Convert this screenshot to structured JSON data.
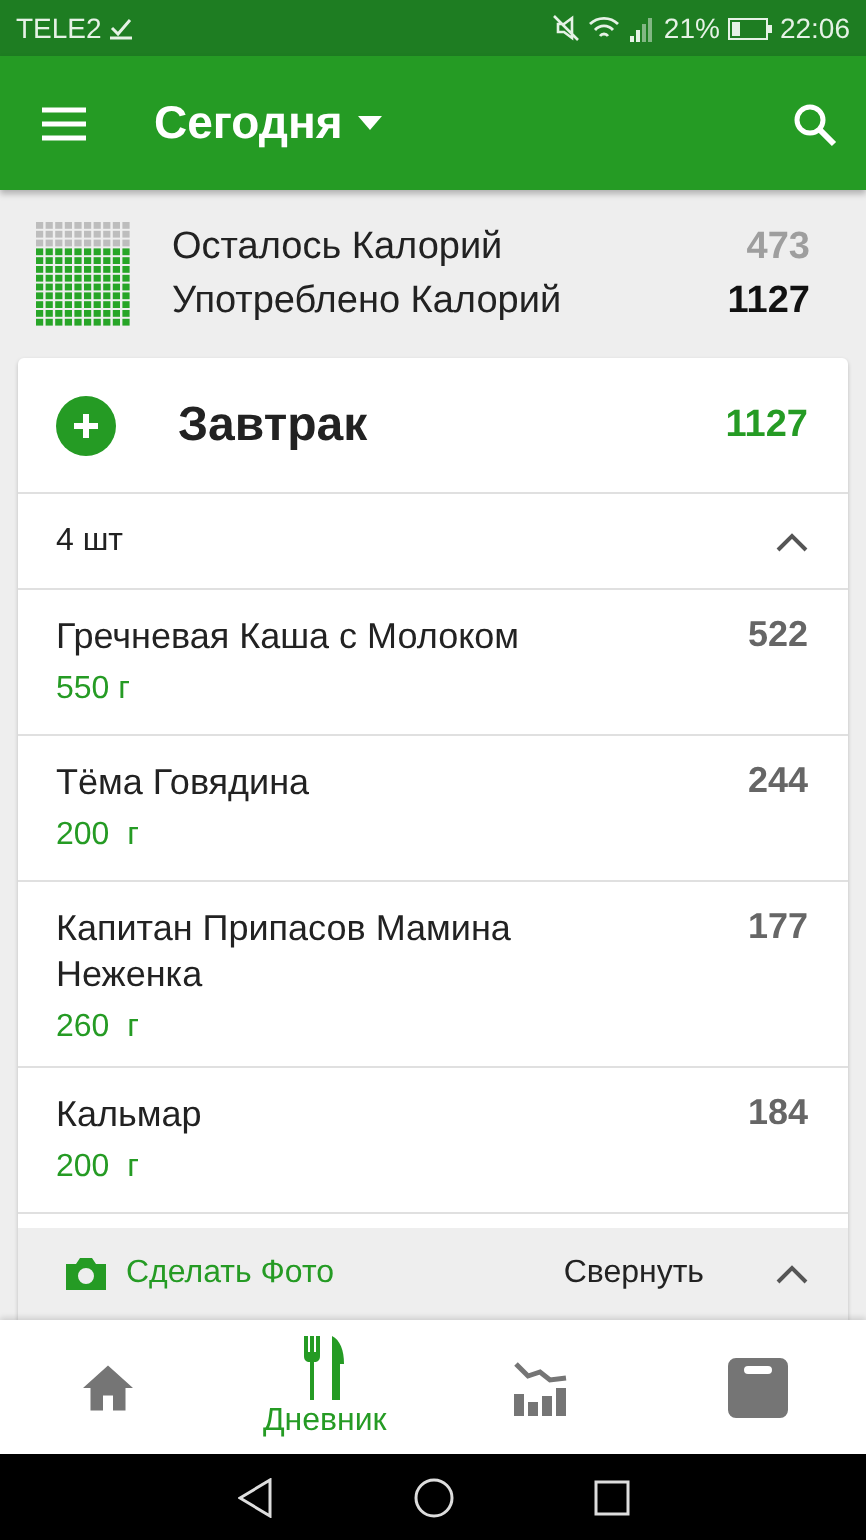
{
  "status_bar": {
    "carrier": "TELE2",
    "battery": "21%",
    "time": "22:06"
  },
  "app_bar": {
    "title": "Сегодня"
  },
  "summary": {
    "rows": [
      {
        "label": "Осталось Калорий",
        "value": "473",
        "kind": "remaining"
      },
      {
        "label": "Употреблено Калорий",
        "value": "1127",
        "kind": "consumed"
      }
    ]
  },
  "meal": {
    "title": "Завтрак",
    "total": "1127",
    "count": "4 шт",
    "expanded": true,
    "items": [
      {
        "name": "Гречневая Каша с Молоком",
        "amount": "550 г",
        "calories": "522"
      },
      {
        "name": "Тёма Говядина",
        "amount": "200  г",
        "calories": "244"
      },
      {
        "name": "Капитан Припасов Мамина Неженка",
        "amount": "260  г",
        "calories": "177"
      },
      {
        "name": "Кальмар",
        "amount": "200  г",
        "calories": "184"
      }
    ],
    "photo_button": "Сделать Фото",
    "collapse_button": "Свернуть"
  },
  "bottom_nav": [
    {
      "kind": "home",
      "selected": false
    },
    {
      "kind": "diary",
      "label": "Дневник",
      "selected": true
    },
    {
      "kind": "stats",
      "selected": false
    },
    {
      "kind": "scale",
      "selected": false
    }
  ]
}
